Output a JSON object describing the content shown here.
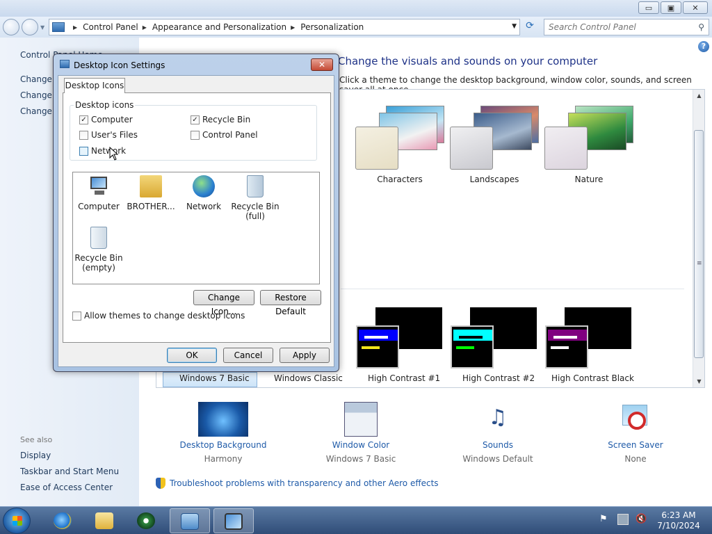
{
  "window": {
    "minimize_label": "▭",
    "maximize_label": "▣",
    "close_label": "✕"
  },
  "address": {
    "crumbs": [
      "Control Panel",
      "Appearance and Personalization",
      "Personalization"
    ]
  },
  "search": {
    "placeholder": "Search Control Panel"
  },
  "sidebar": {
    "home": "Control Panel Home",
    "links": [
      "Change desktop icons",
      "Change mouse pointers",
      "Change your account picture"
    ],
    "see_also_heading": "See also",
    "see_also": [
      "Display",
      "Taskbar and Start Menu",
      "Ease of Access Center"
    ]
  },
  "main": {
    "title": "Change the visuals and sounds on your computer",
    "description": "Click a theme to change the desktop background, window color, sounds, and screen saver all at once."
  },
  "themes": {
    "aero": [
      "Characters",
      "Landscapes",
      "Nature"
    ],
    "basic": [
      "Windows 7 Basic",
      "Windows Classic",
      "High Contrast #1",
      "High Contrast #2",
      "High Contrast Black"
    ],
    "selected": "Windows 7 Basic"
  },
  "bottom": [
    {
      "title": "Desktop Background",
      "sub": "Harmony"
    },
    {
      "title": "Window Color",
      "sub": "Windows 7 Basic"
    },
    {
      "title": "Sounds",
      "sub": "Windows Default"
    },
    {
      "title": "Screen Saver",
      "sub": "None"
    }
  ],
  "troubleshoot": "Troubleshoot problems with transparency and other Aero effects",
  "dialog": {
    "title": "Desktop Icon Settings",
    "tab": "Desktop Icons",
    "group_label": "Desktop icons",
    "checkboxes": [
      {
        "label": "Computer",
        "checked": true
      },
      {
        "label": "Recycle Bin",
        "checked": true
      },
      {
        "label": "User's Files",
        "checked": false
      },
      {
        "label": "Control Panel",
        "checked": false
      },
      {
        "label": "Network",
        "checked": false
      }
    ],
    "icons": [
      "Computer",
      "BROTHER...",
      "Network",
      "Recycle Bin (full)",
      "Recycle Bin (empty)"
    ],
    "change_icon": "Change Icon...",
    "restore_default": "Restore Default",
    "allow_themes": "Allow themes to change desktop icons",
    "ok": "OK",
    "cancel": "Cancel",
    "apply": "Apply"
  },
  "taskbar": {
    "time": "6:23 AM",
    "date": "7/10/2024"
  },
  "colors": {
    "accent_link": "#1e5aa8",
    "hc1_bar": "#0000ff",
    "hc2_bar": "#00ffff",
    "hcblack_bar": "#800080"
  }
}
